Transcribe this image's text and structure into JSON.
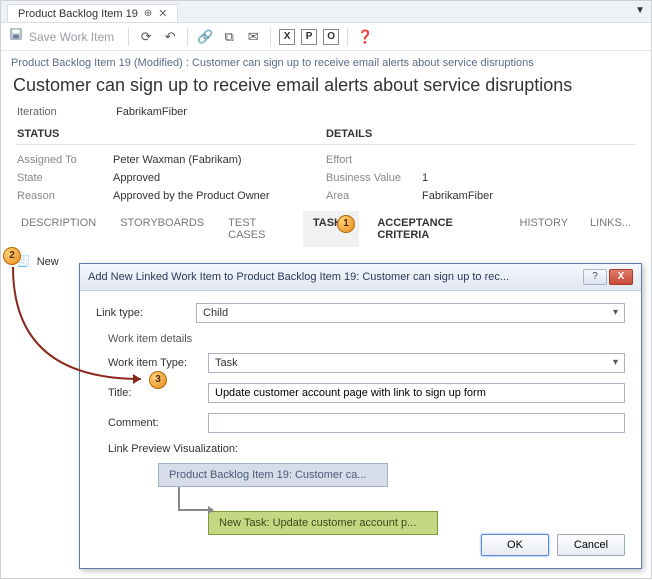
{
  "tab": {
    "title": "Product Backlog Item 19"
  },
  "toolbar": {
    "save": "Save Work Item"
  },
  "breadcrumb": "Product Backlog Item 19 (Modified) : Customer can sign up to receive email alerts about service disruptions",
  "title": "Customer can sign up to receive email alerts about service disruptions",
  "iteration": {
    "label": "Iteration",
    "value": "FabrikamFiber"
  },
  "status": {
    "head": "STATUS",
    "assigned_label": "Assigned To",
    "assigned_val": "Peter Waxman (Fabrikam)",
    "state_label": "State",
    "state_val": "Approved",
    "reason_label": "Reason",
    "reason_val": "Approved by the Product Owner"
  },
  "details": {
    "head": "DETAILS",
    "effort_label": "Effort",
    "effort_val": "",
    "bizval_label": "Business Value",
    "bizval_val": "1",
    "area_label": "Area",
    "area_val": "FabrikamFiber"
  },
  "tabs": {
    "description": "DESCRIPTION",
    "storyboards": "STORYBOARDS",
    "testcases": "TEST CASES",
    "tasks": "TASKS",
    "acceptance": "ACCEPTANCE CRITERIA",
    "history": "HISTORY",
    "links": "LINKS..."
  },
  "newbtn": "New",
  "dialog": {
    "title": "Add New Linked Work Item to Product Backlog Item 19: Customer can sign up to rec...",
    "linktype_label": "Link type:",
    "linktype_val": "Child",
    "details_label": "Work item details",
    "witype_label": "Work item Type:",
    "witype_val": "Task",
    "title_label": "Title:",
    "title_val": "Update customer account page with link to sign up form",
    "comment_label": "Comment:",
    "comment_val": "",
    "preview_label": "Link Preview Visualization:",
    "preview_parent": "Product Backlog Item 19: Customer ca...",
    "preview_child": "New Task: Update customer account p...",
    "ok": "OK",
    "cancel": "Cancel"
  },
  "markers": {
    "m1": "1",
    "m2": "2",
    "m3": "3"
  }
}
